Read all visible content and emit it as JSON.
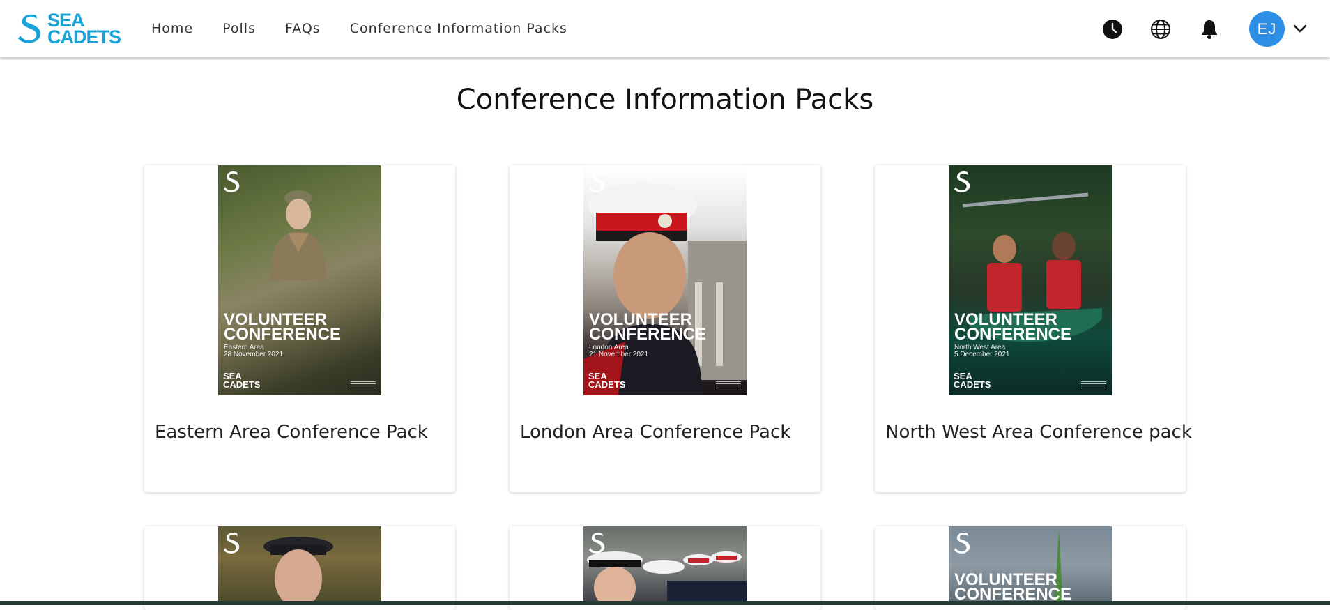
{
  "header": {
    "logo_line1": "SEA",
    "logo_line2": "CADETS",
    "nav": [
      {
        "label": "Home"
      },
      {
        "label": "Polls"
      },
      {
        "label": "FAQs"
      },
      {
        "label": "Conference Information Packs"
      }
    ],
    "icons": [
      "clock-icon",
      "globe-icon",
      "bell-icon"
    ],
    "avatar_initials": "EJ"
  },
  "page_title": "Conference Information Packs",
  "cards": [
    {
      "title": "Eastern Area Conference Pack",
      "cover_line1": "VOLUNTEER",
      "cover_line2": "CONFERENCE",
      "cover_area": "Eastern Area",
      "cover_date": "28 November 2021",
      "cover_brand1": "SEA",
      "cover_brand2": "CADETS"
    },
    {
      "title": "London Area Conference Pack",
      "cover_line1": "VOLUNTEER",
      "cover_line2": "CONFERENCE",
      "cover_area": "London Area",
      "cover_date": "21 November 2021",
      "cover_brand1": "SEA",
      "cover_brand2": "CADETS"
    },
    {
      "title": "North West Area Conference pack",
      "cover_line1": "VOLUNTEER",
      "cover_line2": "CONFERENCE",
      "cover_area": "North West Area",
      "cover_date": "5 December 2021",
      "cover_brand1": "SEA",
      "cover_brand2": "CADETS"
    },
    {
      "title": "",
      "cover_line1": "",
      "cover_line2": ""
    },
    {
      "title": "",
      "cover_line1": "",
      "cover_line2": ""
    },
    {
      "title": "",
      "cover_line1": "VOLUNTEER",
      "cover_line2": "CONFERENCE"
    }
  ],
  "colors": {
    "brand": "#1aa3d8",
    "avatar": "#2d8ee6"
  }
}
